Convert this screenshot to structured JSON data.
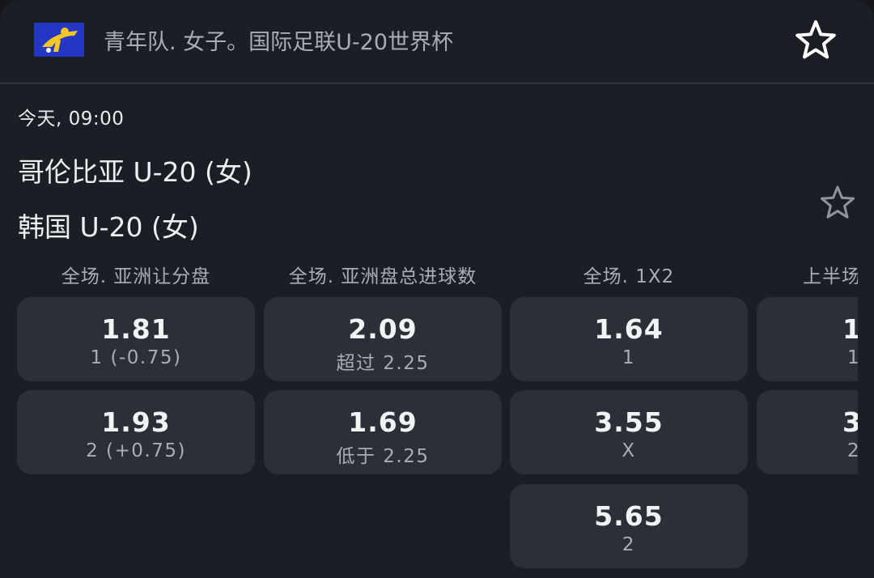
{
  "header": {
    "league_title": "青年队. 女子。国际足联U-20世界杯",
    "logo_icon": "fifa-logo",
    "favorite_icon": "star-outline-icon"
  },
  "match": {
    "time": "今天, 09:00",
    "team1": "哥伦比亚 U-20 (女)",
    "team2": "韩国 U-20 (女)",
    "favorite_icon": "star-outline-icon"
  },
  "markets": [
    {
      "title": "全场. 亚洲让分盘",
      "odds": [
        {
          "value": "1.81",
          "label": "1 (-0.75)"
        },
        {
          "value": "1.93",
          "label": "2 (+0.75)"
        }
      ]
    },
    {
      "title": "全场. 亚洲盘总进球数",
      "odds": [
        {
          "value": "2.09",
          "label": "超过 2.25"
        },
        {
          "value": "1.69",
          "label": "低于 2.25"
        }
      ]
    },
    {
      "title": "全场. 1X2",
      "odds": [
        {
          "value": "1.64",
          "label": "1"
        },
        {
          "value": "3.55",
          "label": "X"
        },
        {
          "value": "5.65",
          "label": "2"
        }
      ]
    },
    {
      "title": "上半场",
      "odds": [
        {
          "value": "1",
          "label": "1"
        },
        {
          "value": "3",
          "label": "2"
        }
      ]
    }
  ],
  "colors": {
    "background": "#1b1e25",
    "button": "#2b2f38",
    "secondary_text": "#a9adb5",
    "primary_text": "#f1f3f5"
  }
}
